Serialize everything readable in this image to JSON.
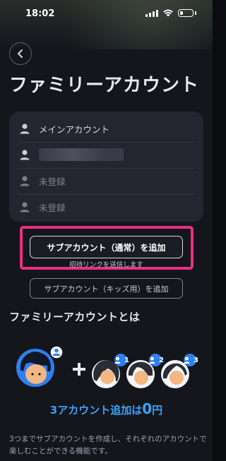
{
  "status_bar": {
    "time": "18:02"
  },
  "header": {
    "title": "ファミリーアカウント"
  },
  "accounts": [
    {
      "label": "メインアカウント",
      "state": "main"
    },
    {
      "label": "",
      "state": "redacted"
    },
    {
      "label": "未登録",
      "state": "empty"
    },
    {
      "label": "未登録",
      "state": "empty"
    }
  ],
  "actions": {
    "add_regular": "サブアカウント（通常）を追加",
    "invite_note": "招待リンクを送信します",
    "add_kids": "サブアカウント（キッズ用）を追加"
  },
  "about": {
    "title": "ファミリーアカウントとは",
    "badges": [
      "1",
      "2",
      "3"
    ],
    "promo_prefix": "3アカウント追加は",
    "promo_value": "0",
    "promo_unit": "円",
    "description": "3つまでサブアカウントを作成し、それぞれのアカウントで楽しむことができる機能です。"
  },
  "colors": {
    "accent_blue": "#3aa3ff",
    "highlight_pink": "#ec2e86",
    "card_bg": "#232630",
    "page_bg": "#14161c"
  }
}
